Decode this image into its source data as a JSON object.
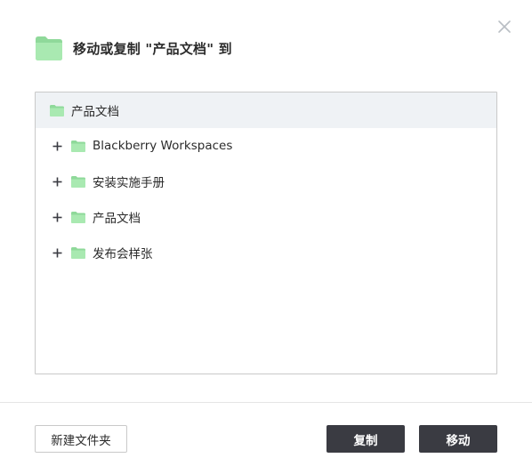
{
  "dialog": {
    "title": "移动或复制 \"产品文档\" 到",
    "header_icon": "folder-icon",
    "close_icon": "close-icon"
  },
  "tree": {
    "root": {
      "label": "产品文档",
      "icon": "folder-icon"
    },
    "items": [
      {
        "label": "Blackberry Workspaces",
        "expander": "+",
        "icon": "folder-icon"
      },
      {
        "label": "安装实施手册",
        "expander": "+",
        "icon": "folder-icon"
      },
      {
        "label": "产品文档",
        "expander": "+",
        "icon": "folder-icon"
      },
      {
        "label": "发布会样张",
        "expander": "+",
        "icon": "folder-icon"
      }
    ]
  },
  "footer": {
    "new_folder_label": "新建文件夹",
    "copy_label": "复制",
    "move_label": "移动"
  },
  "colors": {
    "folder_green": "#9fe3a8",
    "selected_row": "#eff2f5",
    "primary_button": "#3a3b42",
    "border": "#c9c9c9"
  }
}
